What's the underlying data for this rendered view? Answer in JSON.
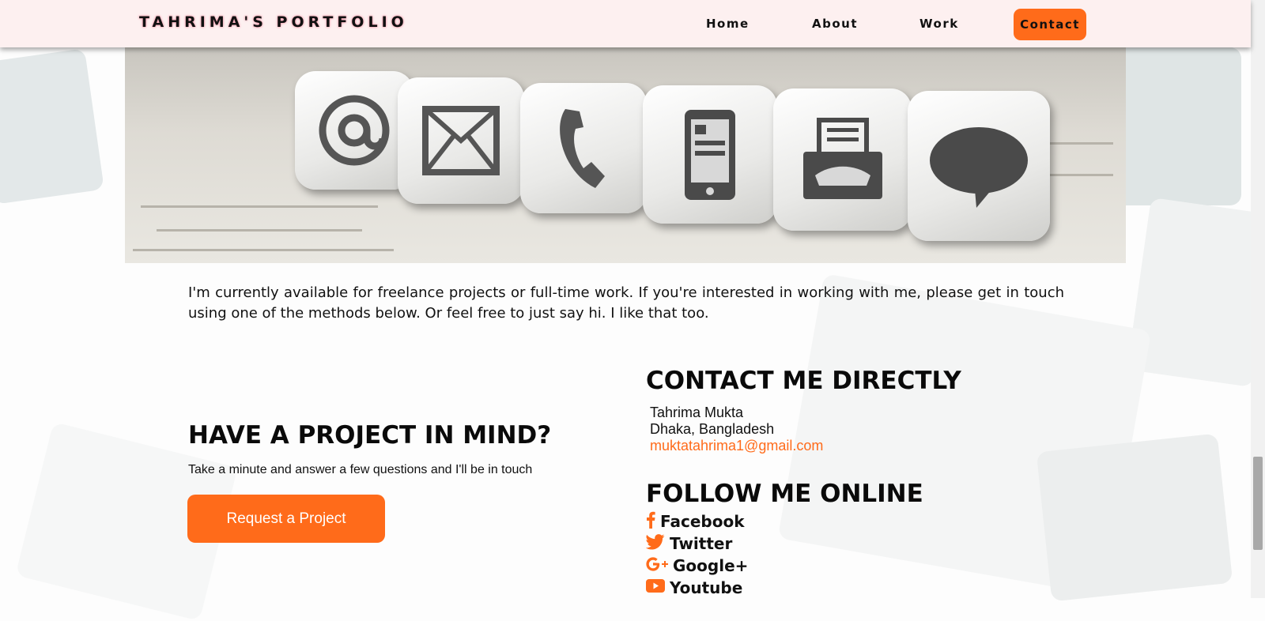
{
  "header": {
    "brand": "TAHRIMA'S PORTFOLIO",
    "nav": [
      {
        "label": "Home"
      },
      {
        "label": "About"
      },
      {
        "label": "Work"
      },
      {
        "label": "Contact"
      }
    ],
    "accent_color": "#ff6b1a"
  },
  "hero": {
    "icons": [
      "at-icon",
      "envelope-icon",
      "phone-icon",
      "tablet-icon",
      "fax-icon",
      "speech-bubble-icon"
    ]
  },
  "intro": {
    "text": "I'm currently available for freelance projects or full-time work. If you're interested in working with me, please get in touch using one of the methods below. Or feel free to just say hi. I like that too."
  },
  "project": {
    "title": "HAVE A PROJECT IN MIND?",
    "subtitle": "Take a minute and answer a few questions and I'll be in touch",
    "button_label": "Request a Project"
  },
  "contact": {
    "title": "CONTACT ME DIRECTLY",
    "name": "Tahrima Mukta",
    "location": "Dhaka, Bangladesh",
    "email": "muktatahrima1@gmail.com"
  },
  "follow": {
    "title": "FOLLOW ME ONLINE",
    "links": [
      {
        "label": "Facebook",
        "icon": "facebook-icon"
      },
      {
        "label": "Twitter",
        "icon": "twitter-icon"
      },
      {
        "label": "Google+",
        "icon": "google-plus-icon"
      },
      {
        "label": "Youtube",
        "icon": "youtube-icon"
      }
    ]
  }
}
